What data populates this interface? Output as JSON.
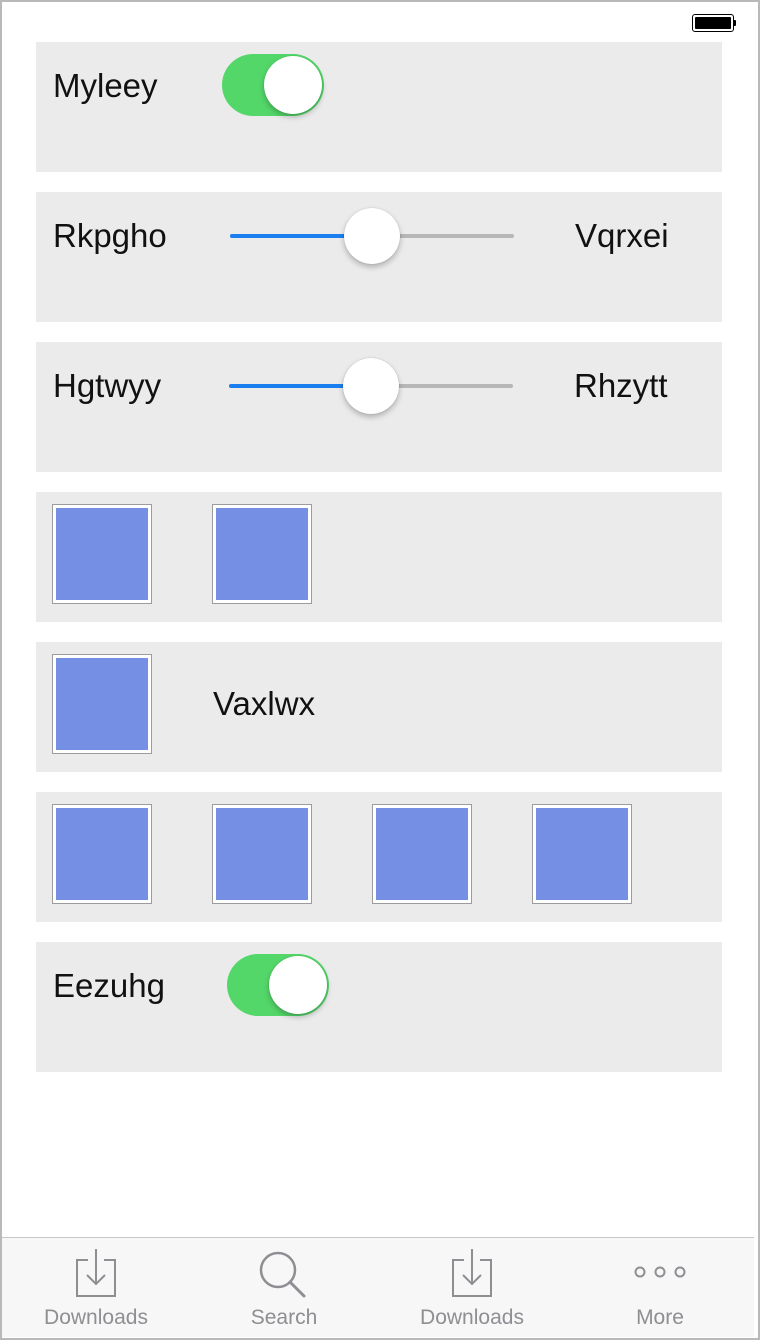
{
  "status_bar": {
    "battery_icon": "battery-full-icon"
  },
  "rows": {
    "row1": {
      "label": "Myleey",
      "switch_on": true
    },
    "row2": {
      "left_label": "Rkpgho",
      "right_label": "Vqrxei",
      "slider_value": 0.5
    },
    "row3": {
      "left_label": "Hgtwyy",
      "right_label": "Rhzytt",
      "slider_value": 0.5
    },
    "row4": {
      "images": 2
    },
    "row5": {
      "label": "Vaxlwx"
    },
    "row6": {
      "images": 4
    },
    "row7": {
      "label": "Eezuhg",
      "switch_on": true
    }
  },
  "colors": {
    "switch_on": "#53d769",
    "slider_min_track": "#1a7ff0",
    "slider_max_track": "#b7b7b7",
    "image_tile": "#758fe4",
    "row_background": "#ebebeb"
  },
  "tabbar": {
    "items": [
      {
        "label": "Downloads",
        "icon": "download-icon"
      },
      {
        "label": "Search",
        "icon": "search-icon"
      },
      {
        "label": "Downloads",
        "icon": "download-icon"
      },
      {
        "label": "More",
        "icon": "more-icon"
      }
    ]
  }
}
